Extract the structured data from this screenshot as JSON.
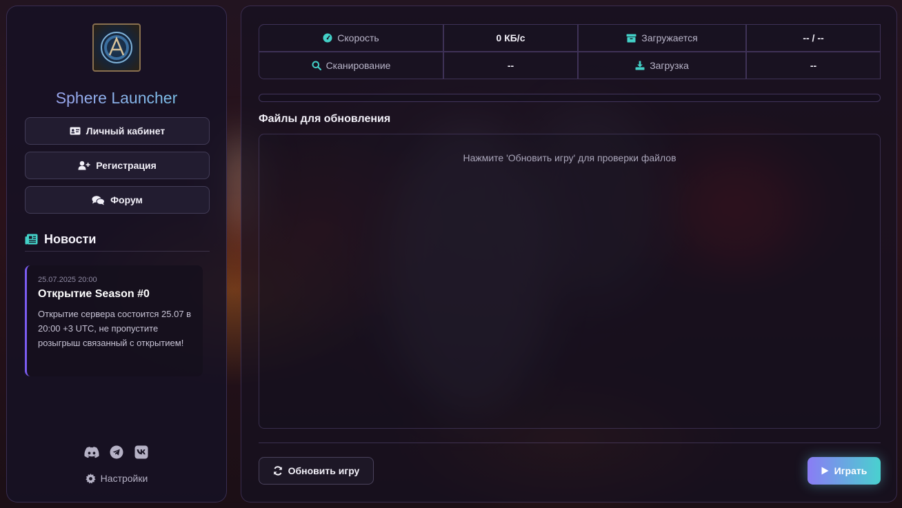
{
  "app": {
    "title": "Sphere Launcher"
  },
  "sidebar": {
    "buttons": [
      {
        "label": "Личный кабинет",
        "icon": "id-card-icon"
      },
      {
        "label": "Регистрация",
        "icon": "user-plus-icon"
      },
      {
        "label": "Форум",
        "icon": "comments-icon"
      }
    ],
    "news": {
      "heading": "Новости",
      "items": [
        {
          "date": "25.07.2025 20:00",
          "title": "Открытие Season #0",
          "text": "Открытие сервера состоится 25.07 в 20:00 +3 UTC, не пропустите розыгрыш связанный с открытием!"
        }
      ]
    },
    "socials": [
      "discord-icon",
      "telegram-icon",
      "vk-icon"
    ],
    "settings_label": "Настройки"
  },
  "stats": {
    "speed_label": "Скорость",
    "speed_value": "0 КБ/с",
    "loading_label": "Загружается",
    "loading_value": "-- / --",
    "scan_label": "Сканирование",
    "scan_value": "--",
    "download_label": "Загрузка",
    "download_value": "--"
  },
  "progress": {
    "fraction": 0
  },
  "files": {
    "title": "Файлы для обновления",
    "empty_message": "Нажмите 'Обновить игру' для проверки файлов"
  },
  "actions": {
    "update_label": "Обновить игру",
    "play_label": "Играть"
  },
  "colors": {
    "accent_purple": "#8a7cf5",
    "accent_teal": "#43d0c7",
    "news_border": "#7b5cf0"
  }
}
